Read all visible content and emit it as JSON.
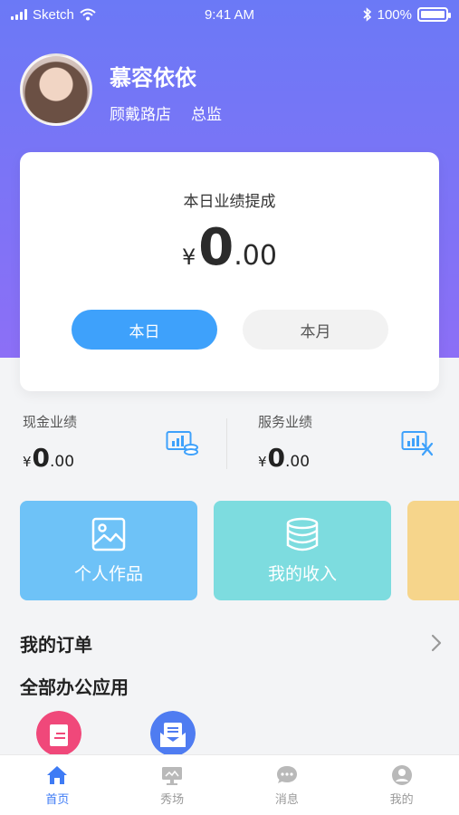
{
  "status_bar": {
    "carrier": "Sketch",
    "time": "9:41 AM",
    "battery": "100%"
  },
  "profile": {
    "name": "慕容依依",
    "store": "顾戴路店",
    "role": "总监"
  },
  "performance": {
    "title": "本日业绩提成",
    "currency": "¥",
    "amount_int": "0",
    "amount_dec": ".00",
    "tabs": {
      "day": "本日",
      "month": "本月"
    }
  },
  "metrics": {
    "cash": {
      "label": "现金业绩",
      "currency": "¥",
      "int": "0",
      "dec": ".00"
    },
    "service": {
      "label": "服务业绩",
      "currency": "¥",
      "int": "0",
      "dec": ".00"
    }
  },
  "tiles": {
    "works": {
      "label": "个人作品",
      "icon": "image-icon",
      "color": "#6ec2f7"
    },
    "income": {
      "label": "我的收入",
      "icon": "database-icon",
      "color": "#7ddcdf"
    },
    "partial": {
      "color": "#f6d58b"
    }
  },
  "sections": {
    "orders": "我的订单",
    "apps": "全部办公应用"
  },
  "tabbar": {
    "items": [
      {
        "label": "首页",
        "icon": "home-icon",
        "active": true
      },
      {
        "label": "秀场",
        "icon": "showcase-icon",
        "active": false
      },
      {
        "label": "消息",
        "icon": "message-icon",
        "active": false
      },
      {
        "label": "我的",
        "icon": "profile-icon",
        "active": false
      }
    ]
  },
  "colors": {
    "accent": "#3ea1fb",
    "gradient_top": "#6b79f6",
    "gradient_bottom": "#8c6ff6",
    "tab_active": "#3e7bf5"
  }
}
